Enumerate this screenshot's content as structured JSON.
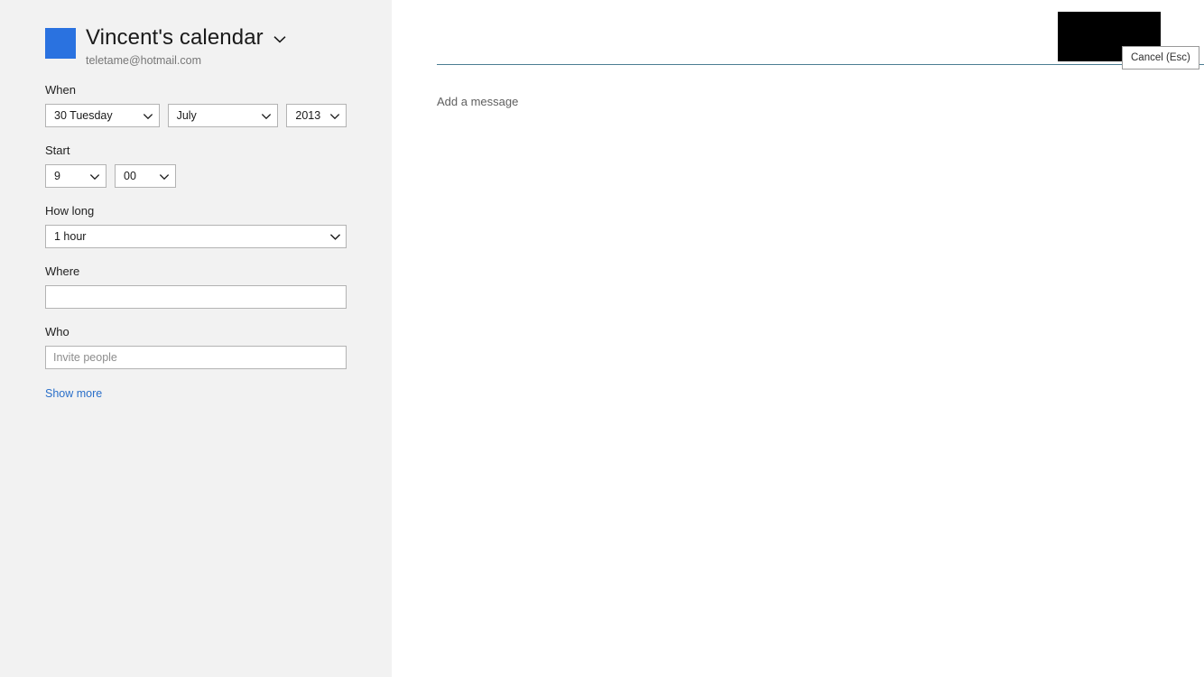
{
  "account": {
    "title": "Vincent's calendar",
    "email": "teletame@hotmail.com",
    "tile_color": "#2a72e0",
    "chevron_icon": "chevron-down-icon"
  },
  "form": {
    "when": {
      "label": "When",
      "day": "30 Tuesday",
      "month": "July",
      "year": "2013"
    },
    "start": {
      "label": "Start",
      "hour": "9",
      "minute": "00"
    },
    "how_long": {
      "label": "How long",
      "value": "1 hour"
    },
    "where": {
      "label": "Where",
      "value": "",
      "placeholder": ""
    },
    "who": {
      "label": "Who",
      "value": "",
      "placeholder": "Invite people"
    },
    "show_more_label": "Show more"
  },
  "main": {
    "message_placeholder": "Add a message",
    "rule_color": "#4c7d93"
  },
  "tooltip": {
    "label": "Cancel (Esc)"
  }
}
